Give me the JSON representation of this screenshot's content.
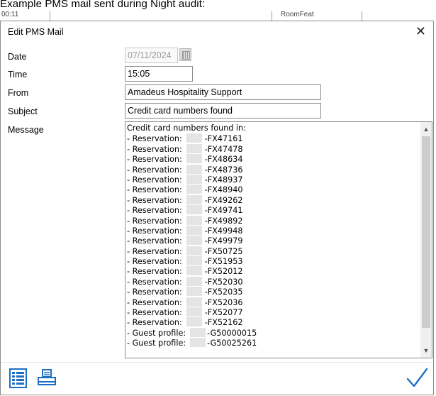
{
  "caption": "Example PMS mail sent during Night audit:",
  "background": {
    "left_text": "00:11",
    "right_text": "RoomFeat"
  },
  "dialog": {
    "title": "Edit PMS Mail",
    "close_icon": "close-icon",
    "fields": {
      "date": {
        "label": "Date",
        "value": "07/11/2024"
      },
      "time": {
        "label": "Time",
        "value": "15:05"
      },
      "from": {
        "label": "From",
        "value": "Amadeus Hospitality Support"
      },
      "subject": {
        "label": "Subject",
        "value": "Credit card numbers found"
      },
      "message": {
        "label": "Message"
      }
    },
    "message_header": "Credit card numbers found in:",
    "message_lines": [
      {
        "prefix": "- Reservation:",
        "suffix": "-FX47161"
      },
      {
        "prefix": "- Reservation:",
        "suffix": "-FX47478"
      },
      {
        "prefix": "- Reservation:",
        "suffix": "-FX48634"
      },
      {
        "prefix": "- Reservation:",
        "suffix": "-FX48736"
      },
      {
        "prefix": "- Reservation:",
        "suffix": "-FX48937"
      },
      {
        "prefix": "- Reservation:",
        "suffix": "-FX48940"
      },
      {
        "prefix": "- Reservation:",
        "suffix": "-FX49262"
      },
      {
        "prefix": "- Reservation:",
        "suffix": "-FX49741"
      },
      {
        "prefix": "- Reservation:",
        "suffix": "-FX49892"
      },
      {
        "prefix": "- Reservation:",
        "suffix": "-FX49948"
      },
      {
        "prefix": "- Reservation:",
        "suffix": "-FX49979"
      },
      {
        "prefix": "- Reservation:",
        "suffix": "-FX50725"
      },
      {
        "prefix": "- Reservation:",
        "suffix": "-FX51953"
      },
      {
        "prefix": "- Reservation:",
        "suffix": "-FX52012"
      },
      {
        "prefix": "- Reservation:",
        "suffix": "-FX52030"
      },
      {
        "prefix": "- Reservation:",
        "suffix": "-FX52035"
      },
      {
        "prefix": "- Reservation:",
        "suffix": "-FX52036"
      },
      {
        "prefix": "- Reservation:",
        "suffix": "-FX52077"
      },
      {
        "prefix": "- Reservation:",
        "suffix": "-FX52162"
      },
      {
        "prefix": "- Guest profile:",
        "suffix": "-G50000015"
      },
      {
        "prefix": "- Guest profile:",
        "suffix": "-G50025261"
      }
    ],
    "footer": {
      "left_icons": [
        "list-icon",
        "print-icon"
      ],
      "confirm_icon": "checkmark-icon",
      "accent_color": "#1e6fc4"
    }
  }
}
